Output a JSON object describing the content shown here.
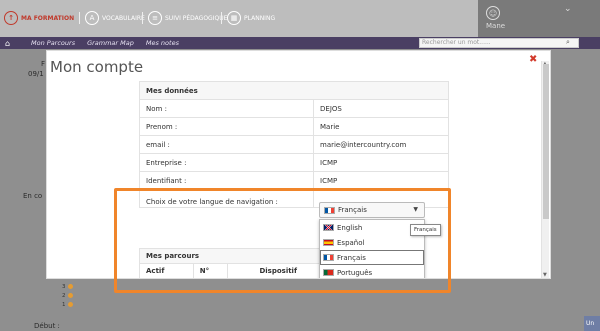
{
  "header": {
    "items": [
      {
        "label": "MA FORMATION",
        "icon": "up-arrow-icon",
        "active": true
      },
      {
        "label": "VOCABULAIRE",
        "icon": "abc-icon",
        "active": false
      },
      {
        "label": "SUIVI PÉDAGOGIQUE",
        "icon": "chart-icon",
        "active": false
      },
      {
        "label": "PLANNING",
        "icon": "calendar-icon",
        "active": false
      }
    ],
    "user_name": "Mane"
  },
  "subnav": {
    "links": [
      "Mon Parcours",
      "Grammar Map",
      "Mes notes"
    ],
    "search_placeholder": "Rechercher un mot......"
  },
  "background": {
    "date_fragment": "09/1",
    "left_fragment_top": "F",
    "en_cours": "En co",
    "debut": "Début :",
    "corner_button": "Un",
    "dots": [
      "3",
      "2",
      "1"
    ]
  },
  "modal": {
    "title": "Mon compte",
    "section_title": "Mes données",
    "rows": [
      {
        "label": "Nom :",
        "value": "DEJOS"
      },
      {
        "label": "Prenom :",
        "value": "Marie"
      },
      {
        "label": "email :",
        "value": "marie@intercountry.com"
      },
      {
        "label": "Entreprise :",
        "value": "ICMP"
      },
      {
        "label": "Identifiant :",
        "value": "ICMP"
      }
    ],
    "language_label": "Choix de votre langue de navigation :",
    "language_selected": "Français",
    "language_options": [
      "English",
      "Español",
      "Français",
      "Português"
    ],
    "tooltip": "Français",
    "parcours_title": "Mes parcours",
    "parcours_columns": [
      "Actif",
      "N°",
      "Dispositif"
    ]
  },
  "colors": {
    "accent": "#c0392b",
    "purple_nav": "#4a3f63",
    "highlight": "#f0852a"
  }
}
